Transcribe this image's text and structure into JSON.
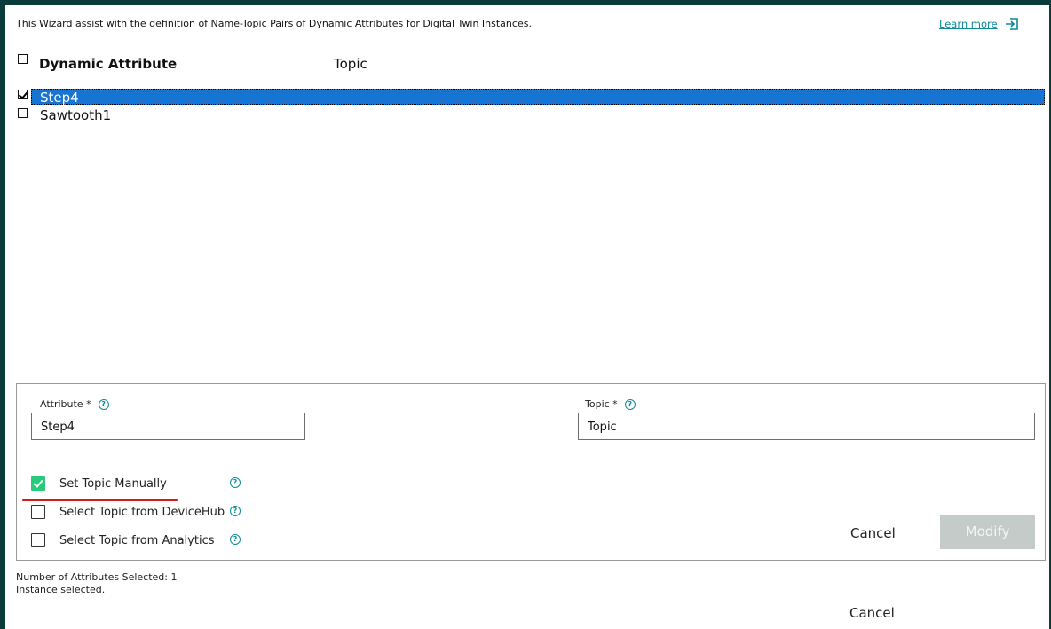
{
  "intro_text": "This Wizard assist with the definition of Name-Topic Pairs of Dynamic Attributes for Digital Twin Instances.",
  "learn_more": "Learn more",
  "table": {
    "headers": [
      "Dynamic Attribute",
      "Topic"
    ],
    "rows": [
      {
        "name": "Step4",
        "checked": true,
        "selected": true
      },
      {
        "name": "Sawtooth1",
        "checked": false,
        "selected": false
      }
    ]
  },
  "form": {
    "attribute_label": "Attribute *",
    "attribute_value": "Step4",
    "topic_label": "Topic *",
    "topic_value": "Topic",
    "options": [
      {
        "label": "Set Topic Manually",
        "checked": true
      },
      {
        "label": "Select Topic from DeviceHub",
        "checked": false
      },
      {
        "label": "Select Topic from Analytics",
        "checked": false
      }
    ],
    "help_glyph": "?",
    "cancel_label": "Cancel",
    "modify_label": "Modify"
  },
  "status": {
    "selected_count": "Number of Attributes Selected: 1",
    "instance": "Instance selected."
  },
  "footer": {
    "cancel_label": "Cancel"
  },
  "colors": {
    "frame": "#0b3b3a",
    "accent": "#0e8a98",
    "selection": "#1874d3",
    "check_on": "#27c97b",
    "annotation": "#d51a1a",
    "disabled_button": "#c5cbc9"
  }
}
